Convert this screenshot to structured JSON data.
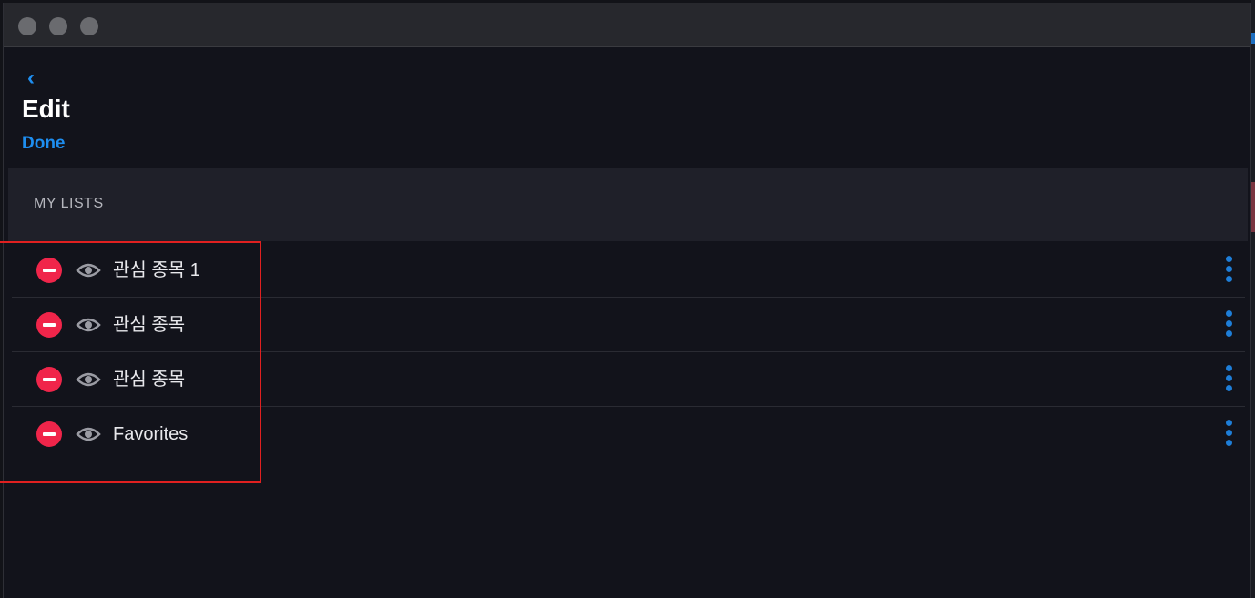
{
  "window": {
    "controls": [
      "close",
      "minimize",
      "zoom"
    ]
  },
  "header": {
    "back_icon": "‹",
    "title": "Edit",
    "done_label": "Done"
  },
  "section": {
    "label": "MY LISTS"
  },
  "lists": [
    {
      "label": "관심 종목 1"
    },
    {
      "label": "관심 종목"
    },
    {
      "label": "관심 종목"
    },
    {
      "label": "Favorites"
    }
  ],
  "colors": {
    "accent": "#1e8ef0",
    "remove": "#f0254a",
    "more": "#1e7ed8",
    "highlight": "#e02020"
  },
  "icons": {
    "remove": "minus-circle-icon",
    "visibility": "eye-icon",
    "more": "vertical-ellipsis-icon",
    "back": "chevron-left-icon"
  }
}
